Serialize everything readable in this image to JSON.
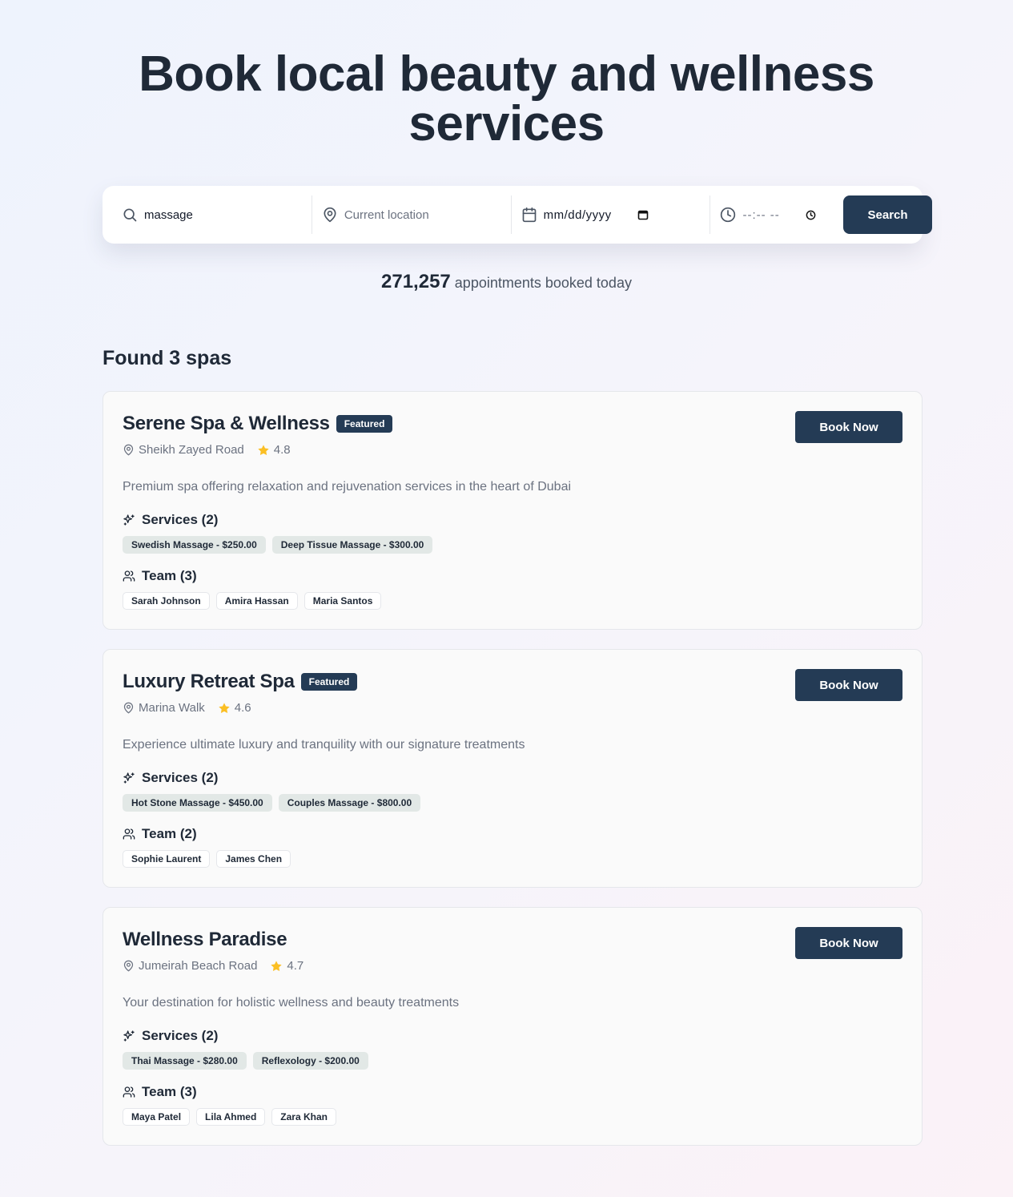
{
  "hero": {
    "title": "Book local beauty and wellness services"
  },
  "search": {
    "query_value": "massage",
    "location_placeholder": "Current location",
    "date_placeholder": "mm/dd/yyyy",
    "time_placeholder": "--:-- --",
    "button_label": "Search"
  },
  "stats": {
    "count": "271,257",
    "label": "appointments booked today"
  },
  "results": {
    "heading": "Found 3 spas"
  },
  "labels": {
    "book_now": "Book Now",
    "featured": "Featured"
  },
  "colors": {
    "primary": "#243b55",
    "star": "#fbbf24",
    "service_chip": "#e2e8e6"
  },
  "spas": [
    {
      "name": "Serene Spa & Wellness",
      "featured": true,
      "location": "Sheikh Zayed Road",
      "rating": "4.8",
      "description": "Premium spa offering relaxation and rejuvenation services in the heart of Dubai",
      "services_heading": "Services (2)",
      "services": [
        "Swedish Massage - $250.00",
        "Deep Tissue Massage - $300.00"
      ],
      "team_heading": "Team (3)",
      "team": [
        "Sarah Johnson",
        "Amira Hassan",
        "Maria Santos"
      ]
    },
    {
      "name": "Luxury Retreat Spa",
      "featured": true,
      "location": "Marina Walk",
      "rating": "4.6",
      "description": "Experience ultimate luxury and tranquility with our signature treatments",
      "services_heading": "Services (2)",
      "services": [
        "Hot Stone Massage - $450.00",
        "Couples Massage - $800.00"
      ],
      "team_heading": "Team (2)",
      "team": [
        "Sophie Laurent",
        "James Chen"
      ]
    },
    {
      "name": "Wellness Paradise",
      "featured": false,
      "location": "Jumeirah Beach Road",
      "rating": "4.7",
      "description": "Your destination for holistic wellness and beauty treatments",
      "services_heading": "Services (2)",
      "services": [
        "Thai Massage - $280.00",
        "Reflexology - $200.00"
      ],
      "team_heading": "Team (3)",
      "team": [
        "Maya Patel",
        "Lila Ahmed",
        "Zara Khan"
      ]
    }
  ]
}
